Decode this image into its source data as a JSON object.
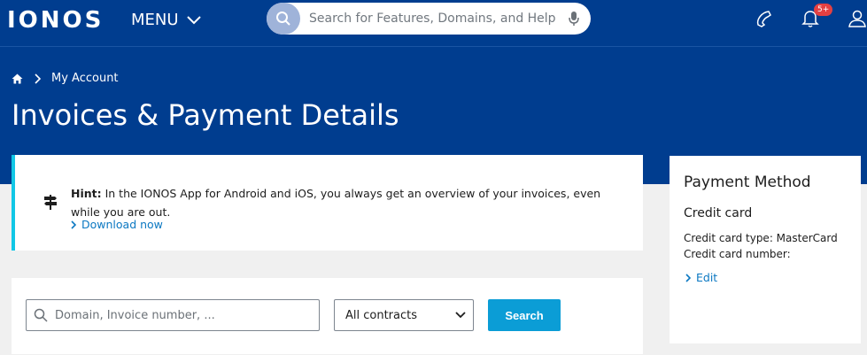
{
  "header": {
    "logo": "IONOS",
    "menu_label": "MENU",
    "search_placeholder": "Search for Features, Domains, and Help",
    "notifications_badge": "5+",
    "icons": [
      "search-icon",
      "microphone-icon",
      "phone-icon",
      "bell-icon",
      "user-icon"
    ]
  },
  "breadcrumb": {
    "current": "My Account"
  },
  "page": {
    "title": "Invoices & Payment Details"
  },
  "hint": {
    "label": "Hint:",
    "text": " In the IONOS App for Android and iOS, you always get an overview of your invoices, even while you are out.",
    "link": "Download now"
  },
  "filters": {
    "domain_placeholder": "Domain, Invoice number, ...",
    "contracts_selected": "All contracts",
    "search_button": "Search"
  },
  "payment": {
    "title": "Payment Method",
    "method": "Credit card",
    "card_type": "Credit card type: MasterCard",
    "card_number": "Credit card number:",
    "edit": "Edit"
  },
  "colors": {
    "brand_blue": "#003d8f",
    "accent_cyan": "#11c7e6",
    "link_blue": "#0b78c2",
    "button_blue": "#0b9dd6",
    "badge_red": "#e34042"
  }
}
